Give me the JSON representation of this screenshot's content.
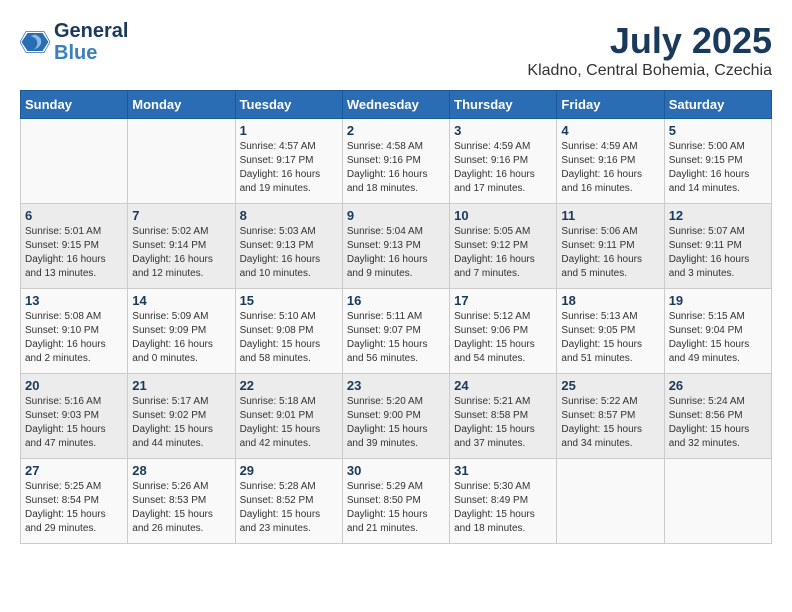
{
  "header": {
    "logo_line1": "General",
    "logo_line2": "Blue",
    "month_year": "July 2025",
    "location": "Kladno, Central Bohemia, Czechia"
  },
  "days_of_week": [
    "Sunday",
    "Monday",
    "Tuesday",
    "Wednesday",
    "Thursday",
    "Friday",
    "Saturday"
  ],
  "weeks": [
    [
      {
        "day": "",
        "sunrise": "",
        "sunset": "",
        "daylight": ""
      },
      {
        "day": "",
        "sunrise": "",
        "sunset": "",
        "daylight": ""
      },
      {
        "day": "1",
        "sunrise": "Sunrise: 4:57 AM",
        "sunset": "Sunset: 9:17 PM",
        "daylight": "Daylight: 16 hours and 19 minutes."
      },
      {
        "day": "2",
        "sunrise": "Sunrise: 4:58 AM",
        "sunset": "Sunset: 9:16 PM",
        "daylight": "Daylight: 16 hours and 18 minutes."
      },
      {
        "day": "3",
        "sunrise": "Sunrise: 4:59 AM",
        "sunset": "Sunset: 9:16 PM",
        "daylight": "Daylight: 16 hours and 17 minutes."
      },
      {
        "day": "4",
        "sunrise": "Sunrise: 4:59 AM",
        "sunset": "Sunset: 9:16 PM",
        "daylight": "Daylight: 16 hours and 16 minutes."
      },
      {
        "day": "5",
        "sunrise": "Sunrise: 5:00 AM",
        "sunset": "Sunset: 9:15 PM",
        "daylight": "Daylight: 16 hours and 14 minutes."
      }
    ],
    [
      {
        "day": "6",
        "sunrise": "Sunrise: 5:01 AM",
        "sunset": "Sunset: 9:15 PM",
        "daylight": "Daylight: 16 hours and 13 minutes."
      },
      {
        "day": "7",
        "sunrise": "Sunrise: 5:02 AM",
        "sunset": "Sunset: 9:14 PM",
        "daylight": "Daylight: 16 hours and 12 minutes."
      },
      {
        "day": "8",
        "sunrise": "Sunrise: 5:03 AM",
        "sunset": "Sunset: 9:13 PM",
        "daylight": "Daylight: 16 hours and 10 minutes."
      },
      {
        "day": "9",
        "sunrise": "Sunrise: 5:04 AM",
        "sunset": "Sunset: 9:13 PM",
        "daylight": "Daylight: 16 hours and 9 minutes."
      },
      {
        "day": "10",
        "sunrise": "Sunrise: 5:05 AM",
        "sunset": "Sunset: 9:12 PM",
        "daylight": "Daylight: 16 hours and 7 minutes."
      },
      {
        "day": "11",
        "sunrise": "Sunrise: 5:06 AM",
        "sunset": "Sunset: 9:11 PM",
        "daylight": "Daylight: 16 hours and 5 minutes."
      },
      {
        "day": "12",
        "sunrise": "Sunrise: 5:07 AM",
        "sunset": "Sunset: 9:11 PM",
        "daylight": "Daylight: 16 hours and 3 minutes."
      }
    ],
    [
      {
        "day": "13",
        "sunrise": "Sunrise: 5:08 AM",
        "sunset": "Sunset: 9:10 PM",
        "daylight": "Daylight: 16 hours and 2 minutes."
      },
      {
        "day": "14",
        "sunrise": "Sunrise: 5:09 AM",
        "sunset": "Sunset: 9:09 PM",
        "daylight": "Daylight: 16 hours and 0 minutes."
      },
      {
        "day": "15",
        "sunrise": "Sunrise: 5:10 AM",
        "sunset": "Sunset: 9:08 PM",
        "daylight": "Daylight: 15 hours and 58 minutes."
      },
      {
        "day": "16",
        "sunrise": "Sunrise: 5:11 AM",
        "sunset": "Sunset: 9:07 PM",
        "daylight": "Daylight: 15 hours and 56 minutes."
      },
      {
        "day": "17",
        "sunrise": "Sunrise: 5:12 AM",
        "sunset": "Sunset: 9:06 PM",
        "daylight": "Daylight: 15 hours and 54 minutes."
      },
      {
        "day": "18",
        "sunrise": "Sunrise: 5:13 AM",
        "sunset": "Sunset: 9:05 PM",
        "daylight": "Daylight: 15 hours and 51 minutes."
      },
      {
        "day": "19",
        "sunrise": "Sunrise: 5:15 AM",
        "sunset": "Sunset: 9:04 PM",
        "daylight": "Daylight: 15 hours and 49 minutes."
      }
    ],
    [
      {
        "day": "20",
        "sunrise": "Sunrise: 5:16 AM",
        "sunset": "Sunset: 9:03 PM",
        "daylight": "Daylight: 15 hours and 47 minutes."
      },
      {
        "day": "21",
        "sunrise": "Sunrise: 5:17 AM",
        "sunset": "Sunset: 9:02 PM",
        "daylight": "Daylight: 15 hours and 44 minutes."
      },
      {
        "day": "22",
        "sunrise": "Sunrise: 5:18 AM",
        "sunset": "Sunset: 9:01 PM",
        "daylight": "Daylight: 15 hours and 42 minutes."
      },
      {
        "day": "23",
        "sunrise": "Sunrise: 5:20 AM",
        "sunset": "Sunset: 9:00 PM",
        "daylight": "Daylight: 15 hours and 39 minutes."
      },
      {
        "day": "24",
        "sunrise": "Sunrise: 5:21 AM",
        "sunset": "Sunset: 8:58 PM",
        "daylight": "Daylight: 15 hours and 37 minutes."
      },
      {
        "day": "25",
        "sunrise": "Sunrise: 5:22 AM",
        "sunset": "Sunset: 8:57 PM",
        "daylight": "Daylight: 15 hours and 34 minutes."
      },
      {
        "day": "26",
        "sunrise": "Sunrise: 5:24 AM",
        "sunset": "Sunset: 8:56 PM",
        "daylight": "Daylight: 15 hours and 32 minutes."
      }
    ],
    [
      {
        "day": "27",
        "sunrise": "Sunrise: 5:25 AM",
        "sunset": "Sunset: 8:54 PM",
        "daylight": "Daylight: 15 hours and 29 minutes."
      },
      {
        "day": "28",
        "sunrise": "Sunrise: 5:26 AM",
        "sunset": "Sunset: 8:53 PM",
        "daylight": "Daylight: 15 hours and 26 minutes."
      },
      {
        "day": "29",
        "sunrise": "Sunrise: 5:28 AM",
        "sunset": "Sunset: 8:52 PM",
        "daylight": "Daylight: 15 hours and 23 minutes."
      },
      {
        "day": "30",
        "sunrise": "Sunrise: 5:29 AM",
        "sunset": "Sunset: 8:50 PM",
        "daylight": "Daylight: 15 hours and 21 minutes."
      },
      {
        "day": "31",
        "sunrise": "Sunrise: 5:30 AM",
        "sunset": "Sunset: 8:49 PM",
        "daylight": "Daylight: 15 hours and 18 minutes."
      },
      {
        "day": "",
        "sunrise": "",
        "sunset": "",
        "daylight": ""
      },
      {
        "day": "",
        "sunrise": "",
        "sunset": "",
        "daylight": ""
      }
    ]
  ]
}
